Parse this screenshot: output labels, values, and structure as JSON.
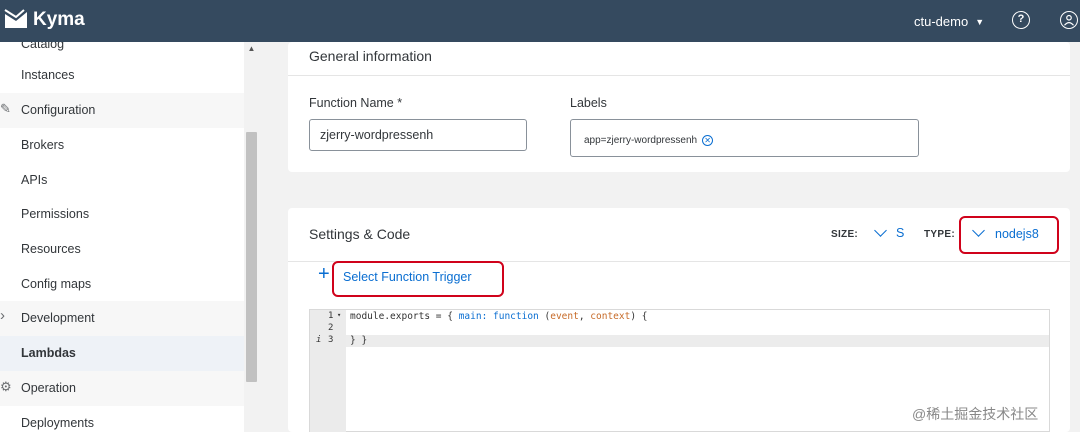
{
  "topbar": {
    "app_name": "Kyma",
    "namespace": "ctu-demo",
    "help_icon": "question-circle-icon",
    "user_icon": "user-circle-icon"
  },
  "sidebar": {
    "items": [
      {
        "label": "Catalog"
      },
      {
        "label": "Instances"
      },
      {
        "label": "Configuration"
      },
      {
        "label": "Brokers"
      },
      {
        "label": "APIs"
      },
      {
        "label": "Permissions"
      },
      {
        "label": "Resources"
      },
      {
        "label": "Config maps"
      },
      {
        "label": "Development"
      },
      {
        "label": "Lambdas"
      },
      {
        "label": "Operation"
      },
      {
        "label": "Deployments"
      }
    ]
  },
  "general": {
    "title": "General information",
    "function_name_label": "Function Name *",
    "function_name_value": "zjerry-wordpressenh",
    "labels_label": "Labels",
    "label_token": "app=zjerry-wordpressenh"
  },
  "settings": {
    "title": "Settings & Code",
    "size_label": "SIZE:",
    "size_value": "S",
    "type_label": "TYPE:",
    "type_value": "nodejs8",
    "trigger_label": "Select Function Trigger",
    "trigger_icon": "plus-icon"
  },
  "editor": {
    "line_numbers": [
      "1",
      "2",
      "3"
    ],
    "lines": {
      "l1_a": "module.exports = ",
      "l1_b": "{ ",
      "l1_c": "main: function",
      "l1_d": " (",
      "l1_e": "event",
      "l1_f": ", ",
      "l1_g": "context",
      "l1_h": ") {",
      "l3": "} }"
    }
  },
  "watermark": "@稀土掘金技术社区",
  "colors": {
    "topbar": "#354a5f",
    "accent": "#0a6ed1",
    "highlight": "#d0021b"
  }
}
